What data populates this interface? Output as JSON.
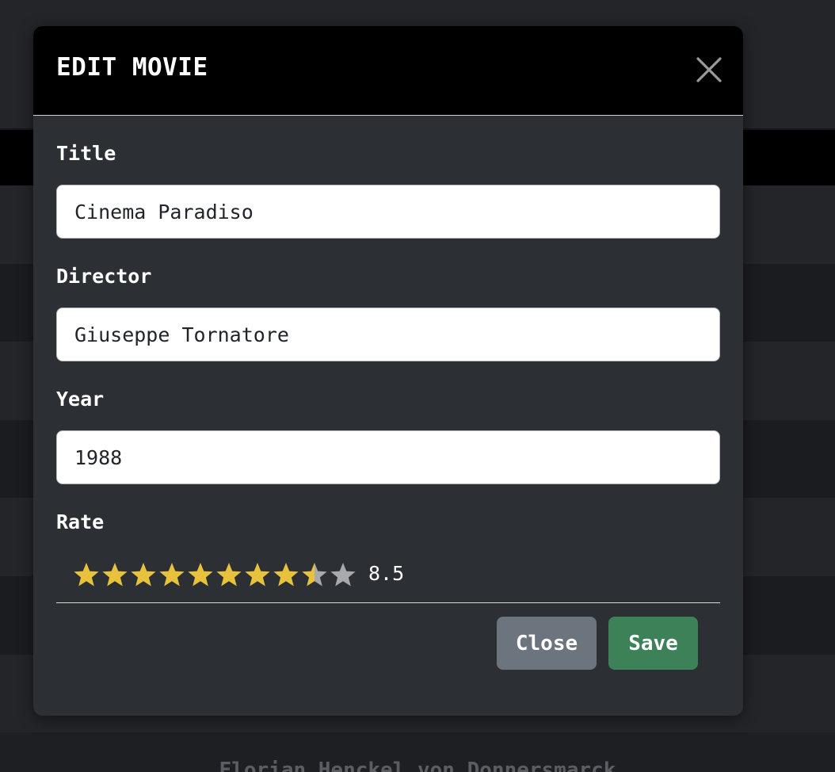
{
  "background": {
    "footer_text": "Florian Henckel von Donnersmarck"
  },
  "modal": {
    "title": "EDIT MOVIE",
    "close_icon": "close-x-icon",
    "fields": {
      "title": {
        "label": "Title",
        "value": "Cinema Paradiso"
      },
      "director": {
        "label": "Director",
        "value": "Giuseppe Tornatore"
      },
      "year": {
        "label": "Year",
        "value": "1988"
      }
    },
    "rate": {
      "label": "Rate",
      "value": 8.5,
      "value_text": "8.5",
      "max": 10,
      "star_icon": "star-icon"
    },
    "buttons": {
      "close_label": "Close",
      "save_label": "Save"
    },
    "colors": {
      "star_filled": "#e8c23d",
      "star_empty": "#a7a9ac",
      "close_button": "#6c757d",
      "save_button": "#3c8158",
      "header": "#000000",
      "body": "#2c2f34"
    }
  }
}
